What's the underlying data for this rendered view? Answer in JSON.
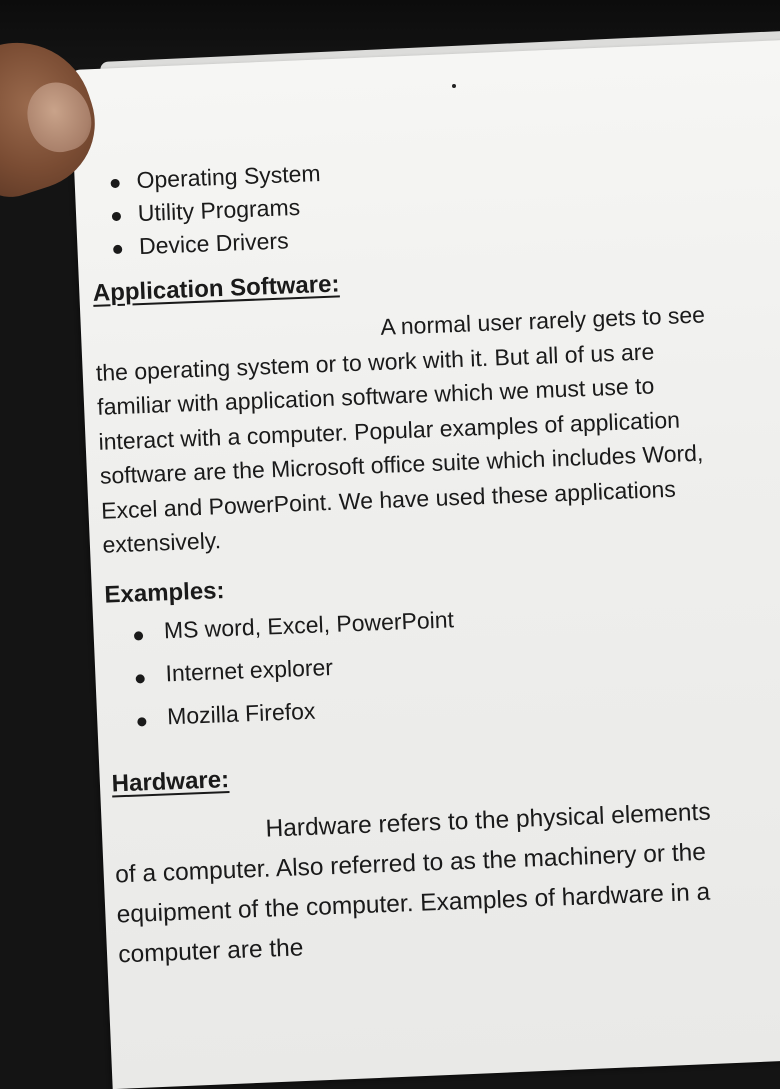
{
  "bullets_top": [
    {
      "text": "Operating System"
    },
    {
      "text": "Utility Programs"
    },
    {
      "text": "Device Drivers"
    }
  ],
  "application_heading": "Application Software:",
  "application_paragraph": "A normal user rarely gets to see the operating system or to work with it. But all of us are familiar with application software which we must use to interact with a computer. Popular examples of application software are the Microsoft office suite which includes Word, Excel and PowerPoint. We have used these applications extensively.",
  "examples_heading": "Examples:",
  "examples": [
    {
      "text": "MS word, Excel, PowerPoint"
    },
    {
      "text": "Internet explorer"
    },
    {
      "text": "Mozilla Firefox"
    }
  ],
  "hardware_heading": "Hardware:",
  "hardware_paragraph": "Hardware refers to the physical elements of a computer. Also referred to as the machinery or the equipment of the computer. Examples of hardware in a computer are the"
}
